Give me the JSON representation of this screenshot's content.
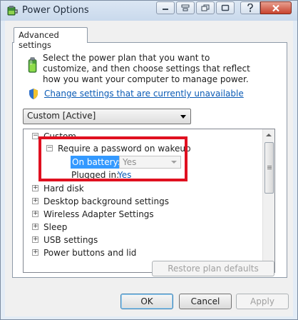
{
  "window": {
    "title": "Power Options"
  },
  "tab": {
    "label": "Advanced settings"
  },
  "description": "Select the power plan that you want to customize, and then choose settings that reflect how you want your computer to manage power.",
  "change_link": "Change settings that are currently unavailable",
  "plan_select": {
    "value": "Custom [Active]"
  },
  "tree": {
    "root": {
      "label": "Custom",
      "toggle": "−"
    },
    "require_password": {
      "label": "Require a password on wakeup",
      "toggle": "−"
    },
    "on_battery": {
      "label": "On battery:",
      "value": "Yes"
    },
    "plugged_in": {
      "label": "Plugged in:",
      "value": "Yes"
    },
    "items": [
      {
        "label": "Hard disk",
        "toggle": "+"
      },
      {
        "label": "Desktop background settings",
        "toggle": "+"
      },
      {
        "label": "Wireless Adapter Settings",
        "toggle": "+"
      },
      {
        "label": "Sleep",
        "toggle": "+"
      },
      {
        "label": "USB settings",
        "toggle": "+"
      },
      {
        "label": "Power buttons and lid",
        "toggle": "+"
      }
    ]
  },
  "buttons": {
    "restore": "Restore plan defaults",
    "ok": "OK",
    "cancel": "Cancel",
    "apply": "Apply"
  },
  "colors": {
    "highlight_box": "#e01020",
    "link": "#0b5bb5",
    "selection": "#3399ff"
  }
}
